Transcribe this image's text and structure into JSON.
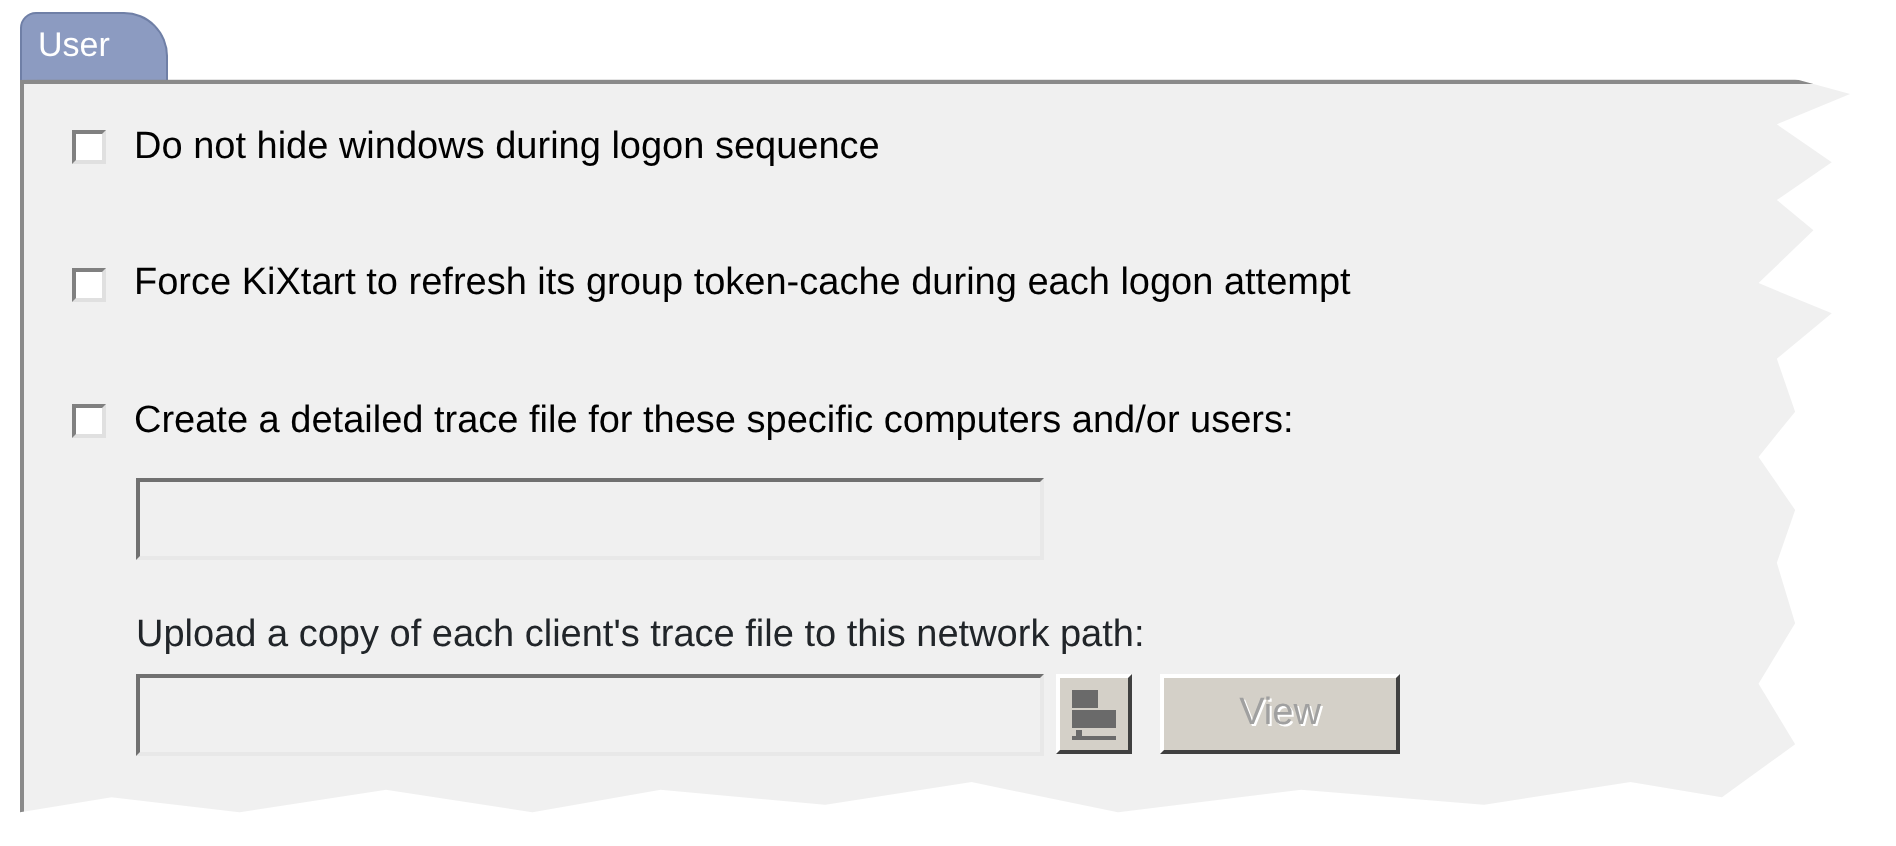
{
  "tabs": [
    {
      "label": "User",
      "selected": true
    }
  ],
  "options": [
    {
      "label": "Do not hide windows during logon sequence",
      "checked": false
    },
    {
      "label": "Force KiXtart to refresh its group token-cache during each logon attempt",
      "checked": false
    },
    {
      "label": "Create a detailed trace file for these specific computers and/or users:",
      "checked": false
    }
  ],
  "trace_targets_field": {
    "disabled": true
  },
  "upload_label": "Upload a copy of each client's trace file to this network path:",
  "network_path_field": {
    "disabled": true
  },
  "browse_button": {
    "disabled": true
  },
  "view_button": {
    "label": "View",
    "disabled": true
  }
}
